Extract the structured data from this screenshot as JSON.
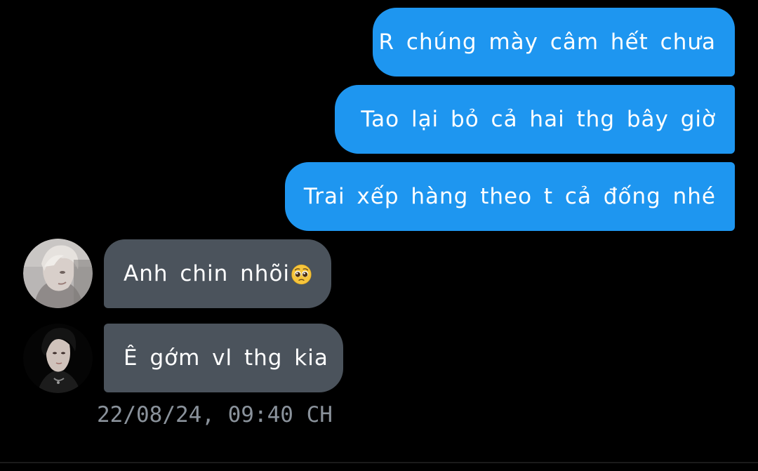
{
  "messages": [
    {
      "direction": "outgoing",
      "text": "R chúng mày câm hết chưa"
    },
    {
      "direction": "outgoing",
      "text": "Tao lại bỏ cả hai thg bây giờ"
    },
    {
      "direction": "outgoing",
      "text": "Trai xếp hàng theo t cả đống nhé"
    },
    {
      "direction": "incoming",
      "text": "Anh chin nhõi",
      "emoji": "pleading-face-emoji"
    },
    {
      "direction": "incoming",
      "text": "Ê gớm vl thg kia"
    }
  ],
  "timestamp": "22/08/24, 09:40 CH",
  "colors": {
    "background": "#000000",
    "outgoing_bubble": "#1e96f0",
    "incoming_bubble": "#4b535c",
    "timestamp": "#8a929b"
  }
}
